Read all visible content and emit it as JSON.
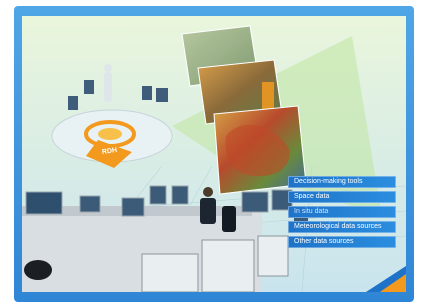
{
  "menu": {
    "items": [
      {
        "label": "Decision-making tools",
        "dim": false
      },
      {
        "label": "Space data",
        "dim": false
      },
      {
        "label": "In situ data",
        "dim": true
      },
      {
        "label": "Meteorological data sources",
        "dim": false
      },
      {
        "label": "Other data sources",
        "dim": false
      }
    ]
  },
  "hub_label": "RDH",
  "colors": {
    "frame": "#2f86d6",
    "menu": "#1e73c8",
    "accent_orange": "#f39a1e"
  }
}
